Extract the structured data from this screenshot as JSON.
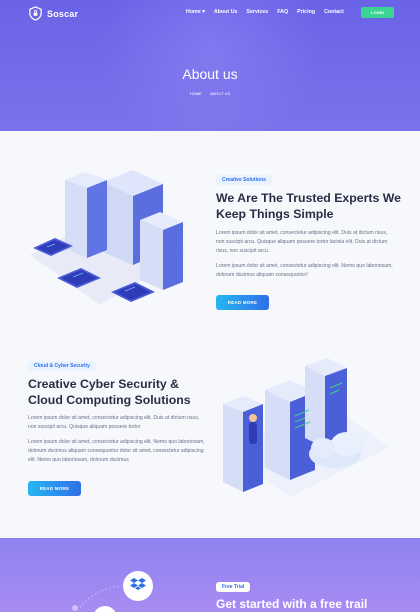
{
  "header": {
    "brand": "Soscar",
    "nav": [
      "Home",
      "About Us",
      "Services",
      "FAQ",
      "Pricing",
      "Contact"
    ],
    "login_label": "LOGIN",
    "colors": {
      "hero_bg": "#6a63e6",
      "login_bg": "#3cd494",
      "accent": "#2f6fe8"
    }
  },
  "hero": {
    "title": "About us",
    "breadcrumb": [
      "HOME",
      "ABOUT US"
    ]
  },
  "section1": {
    "tag": "Creative Solutions",
    "heading": "We Are The Trusted Experts We Keep Things Simple",
    "para1": "Lorem ipsum dolor sit amet, consectetur adipiscing elit. Duis at dictum risus, non suscipit arcu. Quisque aliquam posuere tortor lacinia elit. Duis at dictum risus, non suscipit arcu.",
    "para2": "Lorem ipsum dolor sit amet, consectetur adipiscing elit. Nemo quo laboriosam, dolorum ducimus aliquam consequuntur!",
    "button": "READ MORE"
  },
  "section2": {
    "tag": "Cloud & Cyber Security",
    "heading": "Creative Cyber Security & Cloud Computing Solutions",
    "para1": "Lorem ipsum dolor sit amet, consectetur adipiscing elit. Duis at dictum risus, non suscipit arcu. Quisque aliquam posuere tortor",
    "para2": "Lorem ipsum dolor sit amet, consectetur adipiscing elit. Nemo quo laboriosam, dolorum ducimus aliquam consequuntur dolor sit amet, consectetur adipiscing elit. Nemo quo laboriosam, dolorum ducimus",
    "button": "READ MORE"
  },
  "cta": {
    "tag": "Free Trial",
    "heading": "Get started with a free trail",
    "icon": "dropbox-icon"
  }
}
